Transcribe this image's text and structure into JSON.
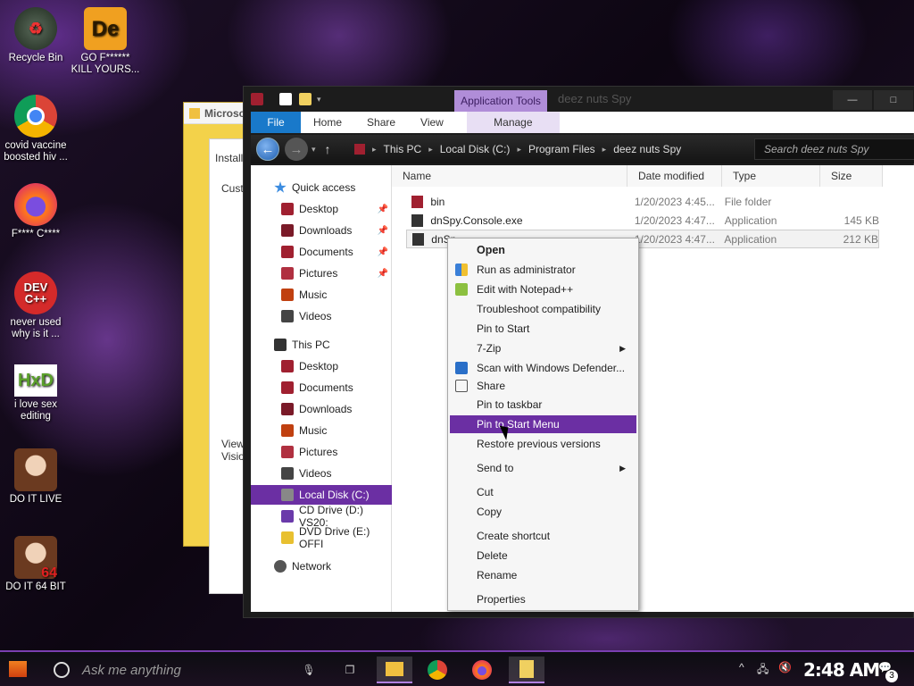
{
  "desktop": {
    "icons": [
      {
        "label": "Recycle Bin"
      },
      {
        "label": "GO F****** KILL YOURS..."
      },
      {
        "label": "covid vaccine boosted hiv ..."
      },
      {
        "label": "F**** C****"
      },
      {
        "label": "never used why is it ..."
      },
      {
        "label": "i love sex editing"
      },
      {
        "label": "DO IT LIVE"
      },
      {
        "label": "DO IT 64 BIT"
      }
    ]
  },
  "bg_window": {
    "title": "Microso",
    "text1": "Installa",
    "text2": "Custo",
    "text3": "Viewe",
    "text4": "Visio"
  },
  "explorer": {
    "app_tools": "Application Tools",
    "title": "deez nuts Spy",
    "ribbon": {
      "file": "File",
      "home": "Home",
      "share": "Share",
      "view": "View",
      "manage": "Manage"
    },
    "breadcrumb": [
      "This PC",
      "Local Disk (C:)",
      "Program Files",
      "deez nuts Spy"
    ],
    "search_placeholder": "Search deez nuts Spy",
    "nav": {
      "quick_access": "Quick access",
      "qa_items": [
        "Desktop",
        "Downloads",
        "Documents",
        "Pictures",
        "Music",
        "Videos"
      ],
      "this_pc": "This PC",
      "pc_items": [
        "Desktop",
        "Documents",
        "Downloads",
        "Music",
        "Pictures",
        "Videos",
        "Local Disk (C:)",
        "CD Drive (D:) VS20:",
        "DVD Drive (E:) OFFI"
      ],
      "network": "Network"
    },
    "columns": {
      "name": "Name",
      "date": "Date modified",
      "type": "Type",
      "size": "Size"
    },
    "files": [
      {
        "name": "bin",
        "date": "1/20/2023 4:45...",
        "type": "File folder",
        "size": ""
      },
      {
        "name": "dnSpy.Console.exe",
        "date": "1/20/2023 4:47...",
        "type": "Application",
        "size": "145 KB"
      },
      {
        "name": "dnSp",
        "date": "1/20/2023 4:47...",
        "type": "Application",
        "size": "212 KB"
      }
    ]
  },
  "context_menu": {
    "items": [
      "Open",
      "Run as administrator",
      "Edit with Notepad++",
      "Troubleshoot compatibility",
      "Pin to Start",
      "7-Zip",
      "Scan with Windows Defender...",
      "Share",
      "Pin to taskbar",
      "Pin to Start Menu",
      "Restore previous versions",
      "Send to",
      "Cut",
      "Copy",
      "Create shortcut",
      "Delete",
      "Rename",
      "Properties"
    ]
  },
  "taskbar": {
    "search_placeholder": "Ask me anything",
    "clock": "2:48 AM",
    "notification_count": "3"
  }
}
